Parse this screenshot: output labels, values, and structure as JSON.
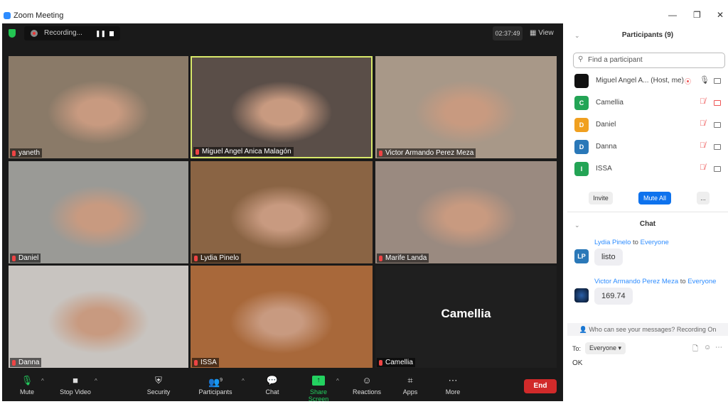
{
  "window": {
    "title": "Zoom Meeting"
  },
  "topbar": {
    "recording_label": "Recording...",
    "timer": "02:37:49",
    "view_label": "View"
  },
  "tiles": [
    {
      "name": "yaneth",
      "bg": "#8a7a68"
    },
    {
      "name": "Miguel Angel Anica Malagón",
      "bg": "#5a4e48",
      "active": true
    },
    {
      "name": "Victor Armando Perez Meza",
      "bg": "#a89888"
    },
    {
      "name": "Daniel",
      "bg": "#9a9a96"
    },
    {
      "name": "Lydia Pinelo",
      "bg": "#8a6444"
    },
    {
      "name": "Marife Landa",
      "bg": "#9a8a80"
    },
    {
      "name": "Danna",
      "bg": "#c8c4c0"
    },
    {
      "name": "ISSA",
      "bg": "#a8683a"
    },
    {
      "name": "Camellia",
      "bg": "#1f1f1f",
      "display_name": "Camellia"
    }
  ],
  "toolbar": {
    "mute": "Mute",
    "stop_video": "Stop Video",
    "security": "Security",
    "participants": "Participants",
    "participants_count": "9",
    "chat": "Chat",
    "share_screen": "Share Screen",
    "reactions": "Reactions",
    "apps": "Apps",
    "more": "More",
    "end": "End"
  },
  "participants": {
    "title": "Participants (9)",
    "search_placeholder": "Find a participant",
    "list": [
      {
        "name": "Miguel Angel A...",
        "tag": "(Host, me)",
        "initial": "",
        "color": "#111111"
      },
      {
        "name": "Camellia",
        "initial": "C",
        "color": "#23a455"
      },
      {
        "name": "Daniel",
        "initial": "D",
        "color": "#f0a020"
      },
      {
        "name": "Danna",
        "initial": "D",
        "color": "#2a78b8"
      },
      {
        "name": "ISSA",
        "initial": "I",
        "color": "#23a455"
      }
    ],
    "invite": "Invite",
    "mute_all": "Mute All",
    "more": "..."
  },
  "chat": {
    "title": "Chat",
    "messages": [
      {
        "from": "Lydia Pinelo",
        "to_word": "to",
        "to": "Everyone",
        "text": "listo",
        "initials": "LP"
      },
      {
        "from": "Victor Armando Perez Meza",
        "to_word": "to",
        "to": "Everyone",
        "text": "169.74"
      }
    ],
    "notice": "Who can see your messages? Recording On",
    "to_label": "To:",
    "recipient": "Everyone",
    "input": "OK"
  },
  "colors": {
    "accent": "#2d8cff",
    "end": "#d12a2a",
    "share": "#23d160",
    "active_speaker": "#d8e86a"
  }
}
